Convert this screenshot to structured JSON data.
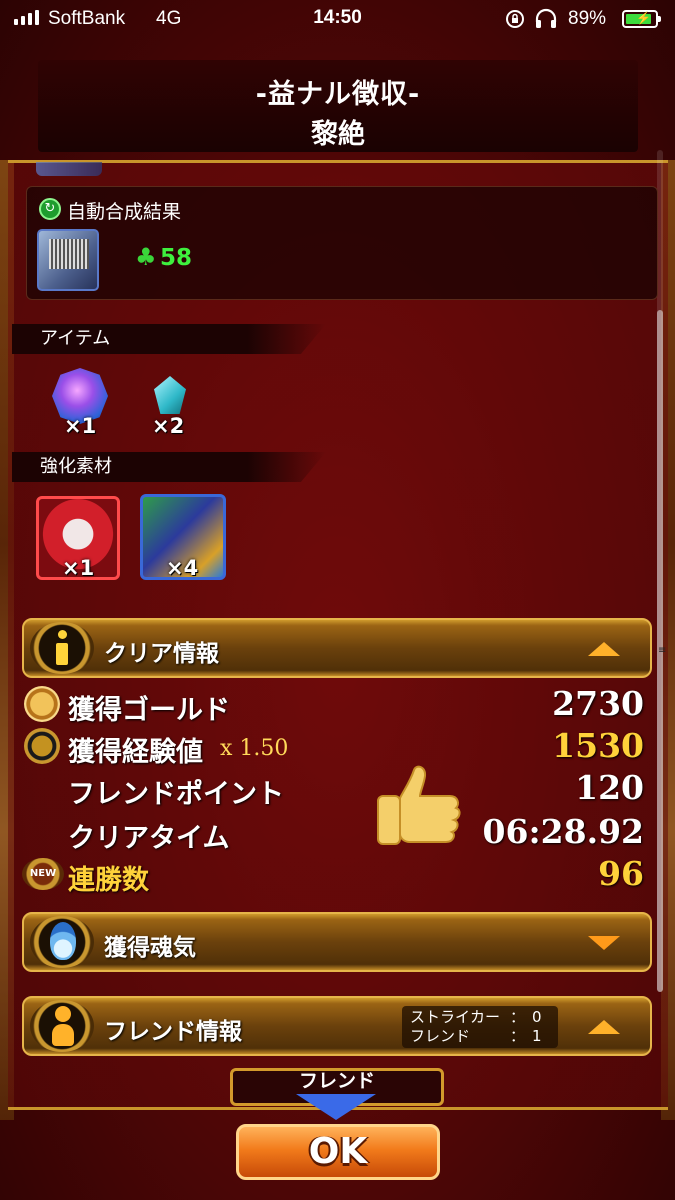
{
  "status_bar": {
    "carrier": "SoftBank",
    "network": "4G",
    "time": "14:50",
    "battery_percent": "89%",
    "battery_level": 0.89
  },
  "quest": {
    "title": "-益ナル徴収-",
    "difficulty": "黎絶"
  },
  "auto_synthesis": {
    "label": "自動合成結果",
    "count": "58",
    "icons": [
      "clover-icon"
    ]
  },
  "items": {
    "header": "アイテム",
    "list": [
      {
        "icon": "orb-icon",
        "count": "×1"
      },
      {
        "icon": "crystal-icon",
        "count": "×2"
      }
    ]
  },
  "materials": {
    "header": "強化素材",
    "list": [
      {
        "icon": "material-monster-red",
        "count": "×1"
      },
      {
        "icon": "material-monster-green",
        "count": "×4"
      }
    ]
  },
  "clear_info": {
    "label": "クリア情報",
    "expanded": true,
    "stats": {
      "gold_label": "獲得ゴールド",
      "gold_value": "2730",
      "exp_label": "獲得経験値",
      "exp_multiplier": "x 1.50",
      "exp_value": "1530",
      "friend_point_label": "フレンドポイント",
      "friend_point_value": "120",
      "clear_time_label": "クリアタイム",
      "clear_time_value": "06:28.92",
      "streak_label": "連勝数",
      "streak_value": "96",
      "streak_badge": "NEW"
    }
  },
  "soul_info": {
    "label": "獲得魂気",
    "expanded": false
  },
  "friend_info": {
    "label": "フレンド情報",
    "striker_label": "ストライカー",
    "striker_value": "0",
    "friend_label": "フレンド",
    "friend_value": "1",
    "separator": "："
  },
  "footer": {
    "friend_tab": "フレンド",
    "ok": "OK"
  },
  "colors": {
    "accent_gold": "#e6b54a",
    "highlight_yellow": "#ffd23a",
    "ok_orange": "#f27b1b"
  }
}
